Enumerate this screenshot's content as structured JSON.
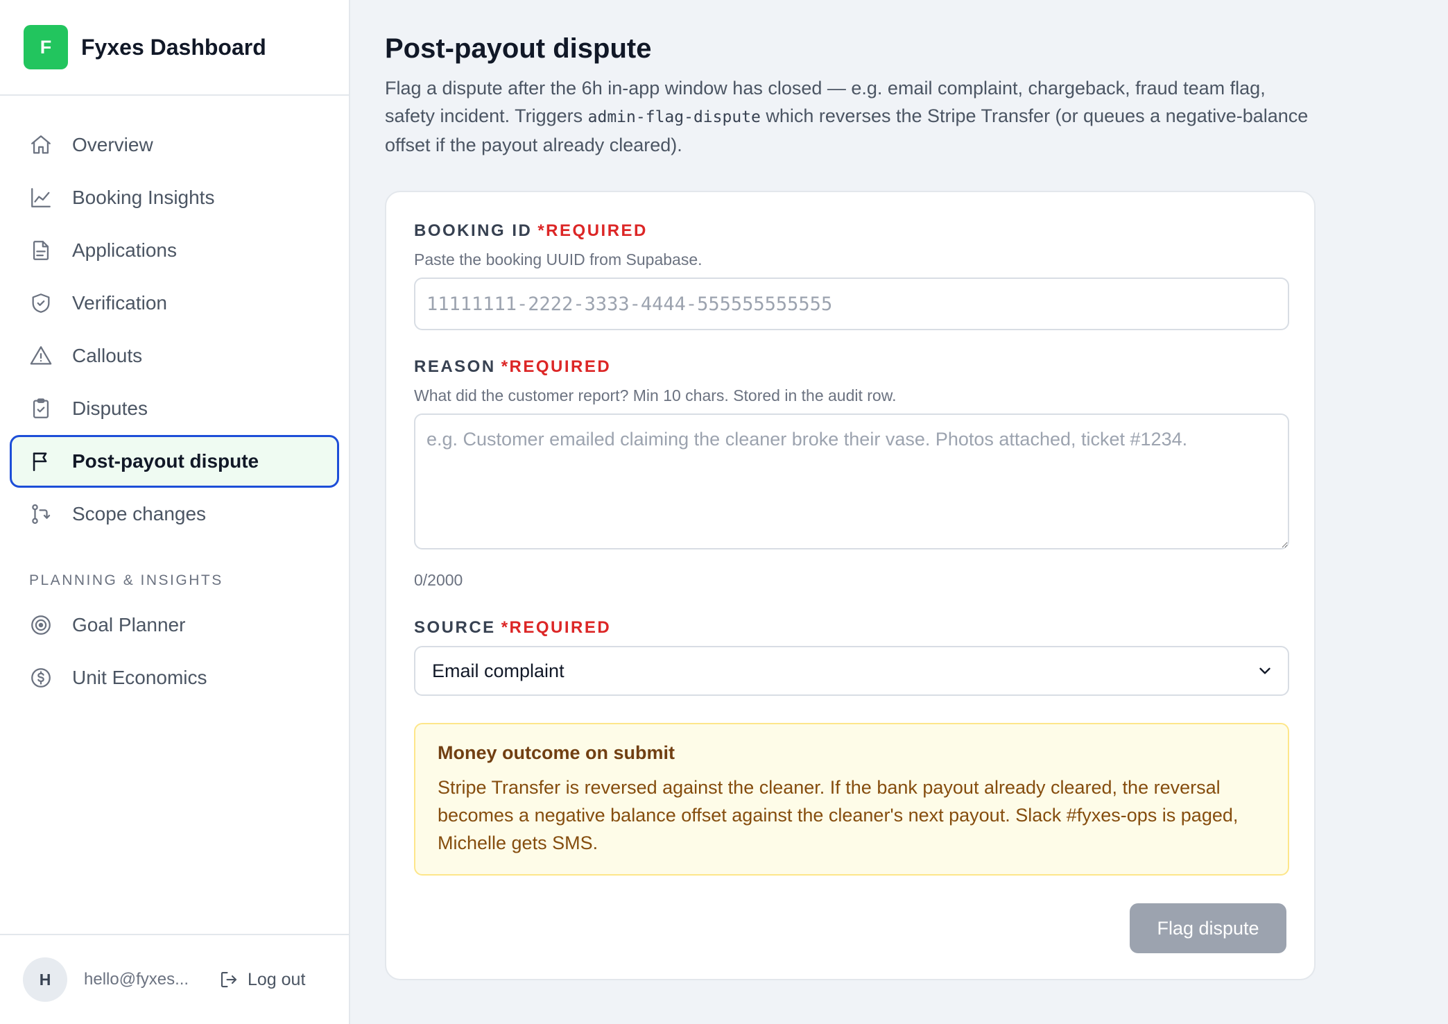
{
  "brand": {
    "logo_letter": "F",
    "name": "Fyxes Dashboard",
    "color": "#22c55e"
  },
  "nav": {
    "items": [
      {
        "label": "Overview",
        "icon": "home-icon"
      },
      {
        "label": "Booking Insights",
        "icon": "line-chart-icon"
      },
      {
        "label": "Applications",
        "icon": "document-icon"
      },
      {
        "label": "Verification",
        "icon": "shield-check-icon"
      },
      {
        "label": "Callouts",
        "icon": "warning-triangle-icon"
      },
      {
        "label": "Disputes",
        "icon": "clipboard-check-icon"
      },
      {
        "label": "Post-payout dispute",
        "icon": "flag-icon",
        "active": true
      },
      {
        "label": "Scope changes",
        "icon": "git-compare-icon"
      }
    ],
    "section_title": "PLANNING & INSIGHTS",
    "section_items": [
      {
        "label": "Goal Planner",
        "icon": "target-icon"
      },
      {
        "label": "Unit Economics",
        "icon": "dollar-circle-icon"
      }
    ]
  },
  "footer": {
    "avatar_letter": "H",
    "email": "hello@fyxes...",
    "logout_label": "Log out"
  },
  "page": {
    "title": "Post-payout dispute",
    "description_before": "Flag a dispute after the 6h in-app window has closed — e.g. email complaint, chargeback, fraud team flag, safety incident. Triggers ",
    "description_code": "admin-flag-dispute",
    "description_after": " which reverses the Stripe Transfer (or queues a negative-balance offset if the payout already cleared)."
  },
  "form": {
    "required_text": "*REQUIRED",
    "booking": {
      "label": "BOOKING ID",
      "help": "Paste the booking UUID from Supabase.",
      "value": "",
      "placeholder": "11111111-2222-3333-4444-555555555555"
    },
    "reason": {
      "label": "REASON",
      "help": "What did the customer report? Min 10 chars. Stored in the audit row.",
      "value": "",
      "placeholder": "e.g. Customer emailed claiming the cleaner broke their vase. Photos attached, ticket #1234.",
      "char_count": "0/2000"
    },
    "source": {
      "label": "SOURCE",
      "selected": "Email complaint"
    },
    "notice": {
      "title": "Money outcome on submit",
      "body": "Stripe Transfer is reversed against the cleaner. If the bank payout already cleared, the reversal becomes a negative balance offset against the cleaner's next payout. Slack #fyxes-ops is paged, Michelle gets SMS."
    },
    "submit_label": "Flag dispute"
  }
}
